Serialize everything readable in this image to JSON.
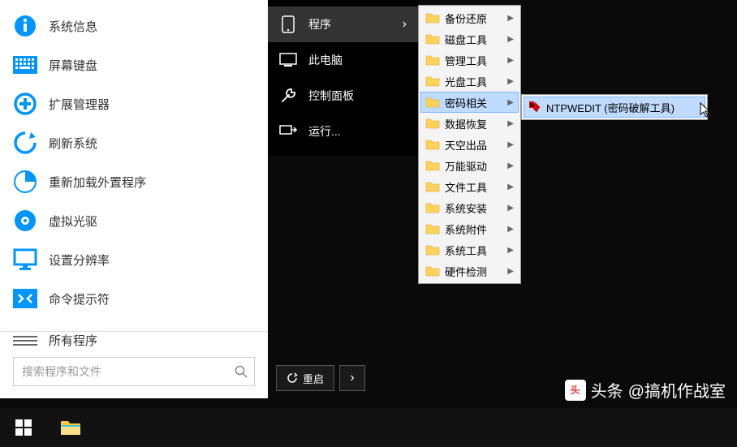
{
  "start_menu": {
    "items": [
      {
        "label": "系统信息",
        "icon": "info"
      },
      {
        "label": "屏幕键盘",
        "icon": "keyboard"
      },
      {
        "label": "扩展管理器",
        "icon": "plus"
      },
      {
        "label": "刷新系统",
        "icon": "refresh"
      },
      {
        "label": "重新加载外置程序",
        "icon": "pie"
      },
      {
        "label": "虚拟光驱",
        "icon": "disc"
      },
      {
        "label": "设置分辨率",
        "icon": "monitor"
      },
      {
        "label": "命令提示符",
        "icon": "code"
      }
    ],
    "all_programs": "所有程序",
    "search_placeholder": "搜索程序和文件"
  },
  "dark_menu": {
    "items": [
      {
        "label": "程序",
        "icon": "phone",
        "has_sub": true,
        "active": true
      },
      {
        "label": "此电脑",
        "icon": "computer"
      },
      {
        "label": "控制面板",
        "icon": "wrench"
      },
      {
        "label": "运行...",
        "icon": "run"
      }
    ]
  },
  "restart": {
    "label": "重启"
  },
  "folder_menu": {
    "items": [
      {
        "label": "备份还原"
      },
      {
        "label": "磁盘工具"
      },
      {
        "label": "管理工具"
      },
      {
        "label": "光盘工具"
      },
      {
        "label": "密码相关",
        "active": true
      },
      {
        "label": "数据恢复"
      },
      {
        "label": "天空出品"
      },
      {
        "label": "万能驱动"
      },
      {
        "label": "文件工具"
      },
      {
        "label": "系统安装"
      },
      {
        "label": "系统附件"
      },
      {
        "label": "系统工具"
      },
      {
        "label": "硬件检测"
      }
    ]
  },
  "app_menu": {
    "items": [
      {
        "label": "NTPWEDIT (密码破解工具)"
      }
    ]
  },
  "watermark": {
    "prefix": "头条",
    "author": "@搞机作战室"
  },
  "colors": {
    "accent": "#0095ff",
    "highlight": "#bfdcff"
  }
}
